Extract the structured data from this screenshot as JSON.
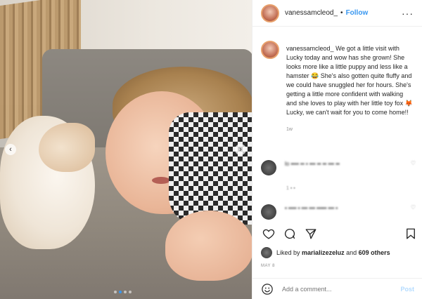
{
  "post": {
    "username": "vanessamcleod_",
    "separator": "•",
    "follow_label": "Follow",
    "more_label": "···",
    "caption_text": "We got a little visit with Lucky today and wow has she grown! She looks more like a little puppy and less like a hamster 😂 She's also gotten quite fluffy and we could have snuggled her for hours. She's getting a little more confident with walking and she loves to play with her little toy fox 🦊 Lucky, we can't wait for you to come home!!",
    "caption_time": "1w",
    "comments": [
      {
        "text": "lo ▪▪▪▪ ▪▪ ▪ ▪▪▪ ▪▪ ▪▪ ▪▪▪ ▪▪",
        "heart": "♡",
        "meta": "1 ▪ ▪"
      },
      {
        "text": "▪ ▪▪▪▪ ▪ ▪▪▪ ▪▪▪ ▪▪▪▪▪ ▪▪▪ ▪",
        "heart": "♡",
        "meta": ""
      }
    ],
    "likes_prefix": "Liked by",
    "likes_user": "marializezeluz",
    "likes_and": "and",
    "likes_others": "609 others",
    "date": "MAY 8",
    "comment_placeholder": "Add a comment...",
    "post_label": "Post",
    "carousel_dots": 4,
    "carousel_active": 1
  },
  "icons": {
    "left_arrow": "‹",
    "right_arrow": "›"
  },
  "colors": {
    "link_blue": "#3897f0",
    "post_disabled": "#b3dbff",
    "text": "#262626",
    "muted": "#8e8e8e"
  }
}
